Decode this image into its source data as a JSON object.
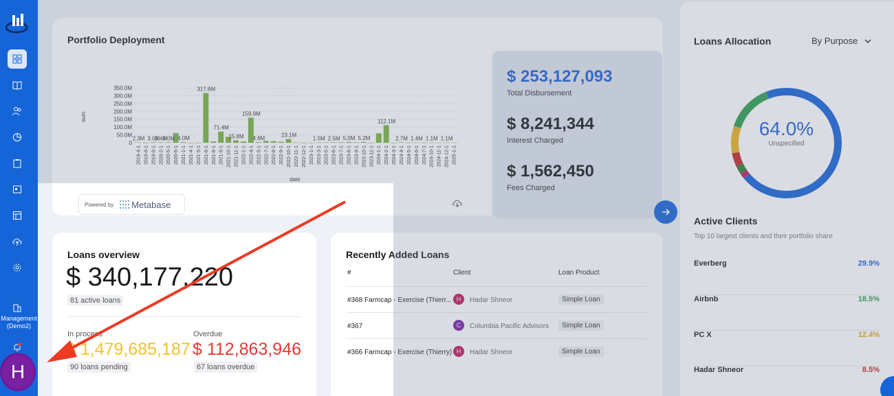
{
  "sidebar": {
    "management_label": "Management (Demo2)",
    "avatar_letter": "H",
    "items": [
      "dashboard-icon",
      "book-icon",
      "users-icon",
      "pie-chart-icon",
      "clipboard-icon",
      "calendar-icon",
      "table-icon",
      "cloud-upload-icon",
      "gear-icon"
    ]
  },
  "portfolio": {
    "title": "Portfolio Deployment",
    "powered_by": "Powered by",
    "brand": "Metabase",
    "metrics": [
      {
        "value": "$ 253,127,093",
        "label": "Total Disbursement"
      },
      {
        "value": "$ 8,241,344",
        "label": "Interest Charged"
      },
      {
        "value": "$ 1,562,450",
        "label": "Fees Charged"
      }
    ]
  },
  "chart_data": {
    "type": "bar",
    "xlabel": "date",
    "ylabel": "sum",
    "ylim": [
      0,
      350
    ],
    "y_ticks": [
      "0",
      "50.0M",
      "100.0M",
      "150.0M",
      "200.0M",
      "250.0M",
      "300.0M",
      "350.0M"
    ],
    "categories": [
      "2019-4-1",
      "2019-8-1",
      "2019-9-1",
      "2020-2-1",
      "2020-5-1",
      "2020-6-1",
      "2021-1-1",
      "2021-4-1",
      "2021-5-1",
      "2021-6-1",
      "2021-8-1",
      "2021-9-1",
      "2021-10-1",
      "2021-11-1",
      "2022-1-1",
      "2022-4-1",
      "2022-5-1",
      "2022-7-1",
      "2022-8-1",
      "2022-9-1",
      "2022-10-1",
      "2022-11-1",
      "2022-12-1",
      "2023-1-1",
      "2023-3-1",
      "2023-5-1",
      "2023-6-1",
      "2023-7-1",
      "2023-8-1",
      "2023-9-1",
      "2023-10-1",
      "2023-11-1",
      "2024-1-1",
      "2024-2-1",
      "2024-3-1",
      "2024-4-1",
      "2024-5-1",
      "2024-6-1",
      "2024-7-1",
      "2024-10-1",
      "2024-11-1",
      "2024-12-1",
      "2025-1-1"
    ],
    "values": [
      2.3,
      0,
      3.0,
      2.4,
      3.0,
      62,
      4.0,
      0,
      0,
      317.6,
      8,
      71.4,
      38,
      15.8,
      8,
      159.9,
      4.6,
      12,
      10,
      6,
      23.1,
      2,
      0,
      0,
      1.5,
      2,
      2.5,
      3,
      5.0,
      3,
      5.2,
      0,
      60,
      112.1,
      0,
      2.7,
      1,
      1.4,
      1,
      1.1,
      1,
      1.1,
      1
    ],
    "data_labels": [
      {
        "i": 0,
        "text": "2.3M"
      },
      {
        "i": 2,
        "text": "3.0M"
      },
      {
        "i": 3,
        "text": "2.4M"
      },
      {
        "i": 4,
        "text": "3.0M"
      },
      {
        "i": 6,
        "text": "4.0M"
      },
      {
        "i": 9,
        "text": "317.6M"
      },
      {
        "i": 11,
        "text": "71.4M"
      },
      {
        "i": 13,
        "text": "15.8M"
      },
      {
        "i": 15,
        "text": "159.9M"
      },
      {
        "i": 16,
        "text": "4.6M"
      },
      {
        "i": 20,
        "text": "23.1M"
      },
      {
        "i": 24,
        "text": "1.5M"
      },
      {
        "i": 26,
        "text": "2.5M"
      },
      {
        "i": 28,
        "text": "5.0M"
      },
      {
        "i": 30,
        "text": "5.2M"
      },
      {
        "i": 33,
        "text": "112.1M"
      },
      {
        "i": 35,
        "text": "2.7M"
      },
      {
        "i": 37,
        "text": "1.4M"
      },
      {
        "i": 39,
        "text": "1.1M"
      },
      {
        "i": 41,
        "text": "1.1M"
      }
    ],
    "bar_color": "#7cb342"
  },
  "allocation": {
    "title": "Loans Allocation",
    "select_value": "By Purpose",
    "donut_pct": "64.0%",
    "donut_label": "Unspecified",
    "slices": [
      {
        "value": 64.0,
        "color": "#1565d8"
      },
      {
        "value": 1.5,
        "color": "#c2185b"
      },
      {
        "value": 2.5,
        "color": "#2e7d32"
      },
      {
        "value": 4.0,
        "color": "#c62828"
      },
      {
        "value": 8.0,
        "color": "#e6b422"
      },
      {
        "value": 14.0,
        "color": "#2e9e4f"
      },
      {
        "value": 6.0,
        "color": "#1565d8"
      }
    ]
  },
  "clients": {
    "title": "Active Clients",
    "subtitle": "Top 10 largest clients and their portfolio share",
    "rows": [
      {
        "name": "Everberg",
        "pct": "29.9%",
        "color": "#1e5fd6"
      },
      {
        "name": "Airbnb",
        "pct": "18.5%",
        "color": "#2e9e4f"
      },
      {
        "name": "PC X",
        "pct": "12.4%",
        "color": "#e6a817"
      },
      {
        "name": "Hadar Shneor",
        "pct": "8.5%",
        "color": "#c62828"
      }
    ]
  },
  "overview": {
    "title": "Loans overview",
    "amount": "$ 340,177,220",
    "active": "81 active loans",
    "in_process_label": "In process",
    "in_process_value": "$ 1,479,685,187",
    "pending": "90 loans pending",
    "overdue_label": "Overdue",
    "overdue_value": "$ 112,863,946",
    "overdue_count": "67 loans overdue"
  },
  "recent": {
    "title": "Recently Added Loans",
    "headers": {
      "id": "#",
      "client": "Client",
      "product": "Loan Product"
    },
    "rows": [
      {
        "id": "#368 Farmcap - Exercise (Thierr...",
        "avatar": "H",
        "avatar_color": "#c2185b",
        "client": "Hadar Shneor",
        "product": "Simple Loan"
      },
      {
        "id": "#367",
        "avatar": "C",
        "avatar_color": "#7b1fa2",
        "client": "Columbia Pacific Advisors",
        "product": "Simple Loan"
      },
      {
        "id": "#366 Farmcap - Exercise (Thierry)",
        "avatar": "H",
        "avatar_color": "#c2185b",
        "client": "Hadar Shneor",
        "product": "Simple Loan"
      }
    ]
  }
}
